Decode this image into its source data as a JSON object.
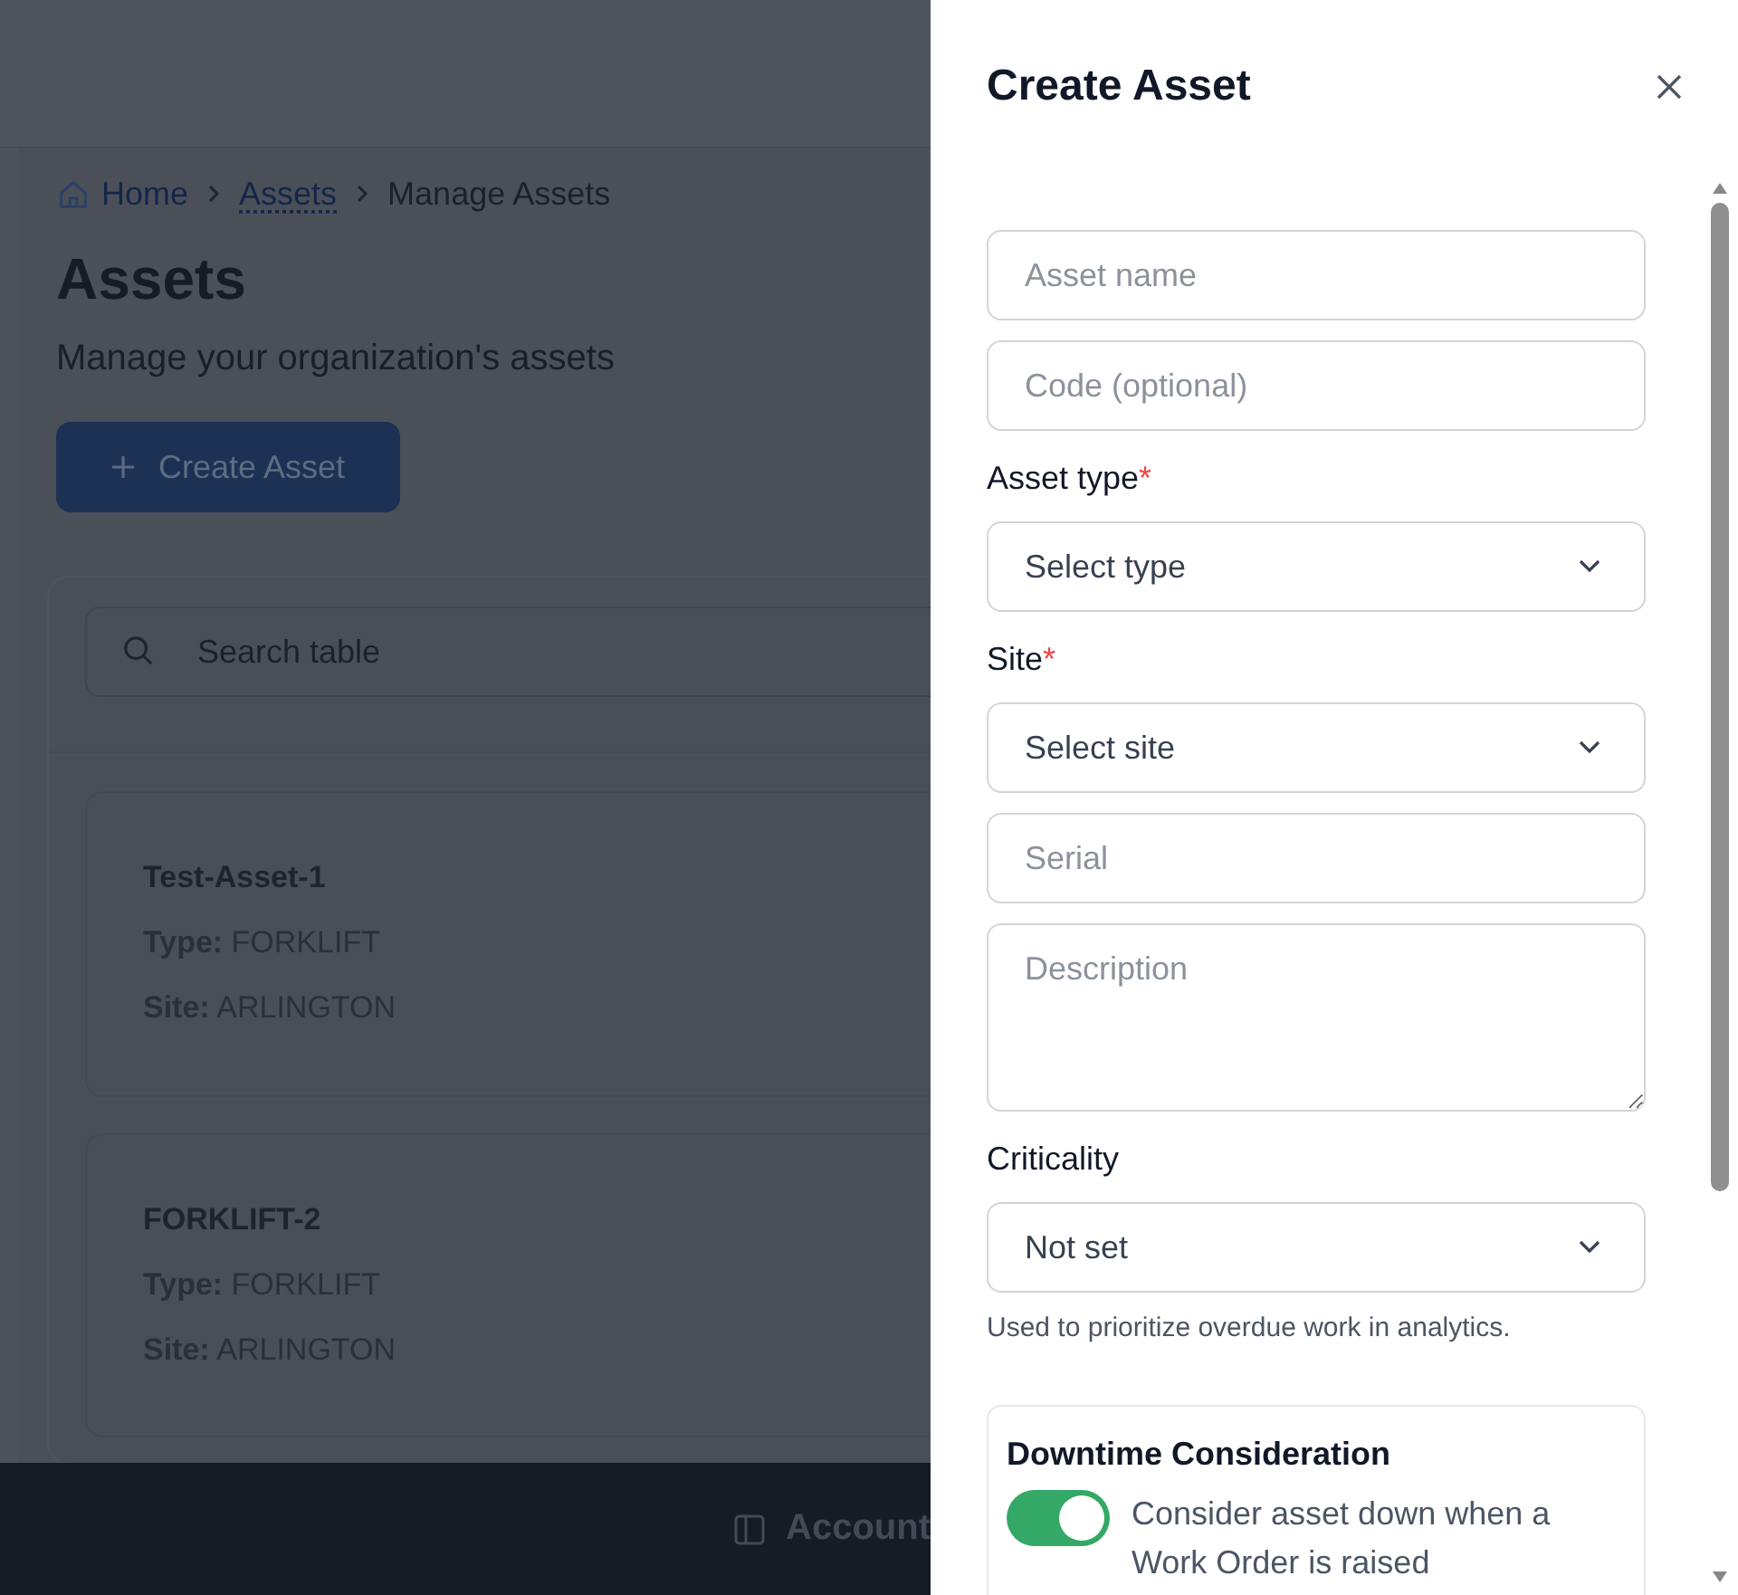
{
  "breadcrumb": [
    {
      "label": "Home",
      "kind": "home"
    },
    {
      "label": "Assets",
      "kind": "link"
    },
    {
      "label": "Manage Assets",
      "kind": "current"
    }
  ],
  "page": {
    "title": "Assets",
    "subtitle": "Manage your organization's assets",
    "create_button": "Create Asset"
  },
  "search": {
    "placeholder": "Search table"
  },
  "cards": [
    {
      "name": "Test-Asset-1",
      "fields": [
        {
          "label": "Type:",
          "value": "FORKLIFT"
        },
        {
          "label": "Site:",
          "value": "ARLINGTON"
        }
      ]
    },
    {
      "name": "FORKLIFT-2",
      "fields": [
        {
          "label": "Type:",
          "value": "FORKLIFT"
        },
        {
          "label": "Site:",
          "value": "ARLINGTON"
        }
      ]
    }
  ],
  "footer": {
    "account": "Account"
  },
  "drawer": {
    "title": "Create Asset",
    "fields": [
      {
        "kind": "text",
        "placeholder": "Asset name"
      },
      {
        "kind": "text",
        "placeholder": "Code (optional)"
      },
      {
        "kind": "select",
        "label": "Asset type",
        "required_mark": "*",
        "value": "Select type"
      },
      {
        "kind": "select",
        "label": "Site",
        "required_mark": "*",
        "value": "Select site"
      },
      {
        "kind": "text",
        "placeholder": "Serial"
      },
      {
        "kind": "textarea",
        "placeholder": "Description"
      },
      {
        "kind": "select",
        "label": "Criticality",
        "value": "Not set",
        "help": "Used to prioritize overdue work in analytics."
      }
    ],
    "downtime": {
      "title": "Downtime Consideration",
      "on": true,
      "label": "Consider asset down when a Work Order is raised"
    }
  }
}
